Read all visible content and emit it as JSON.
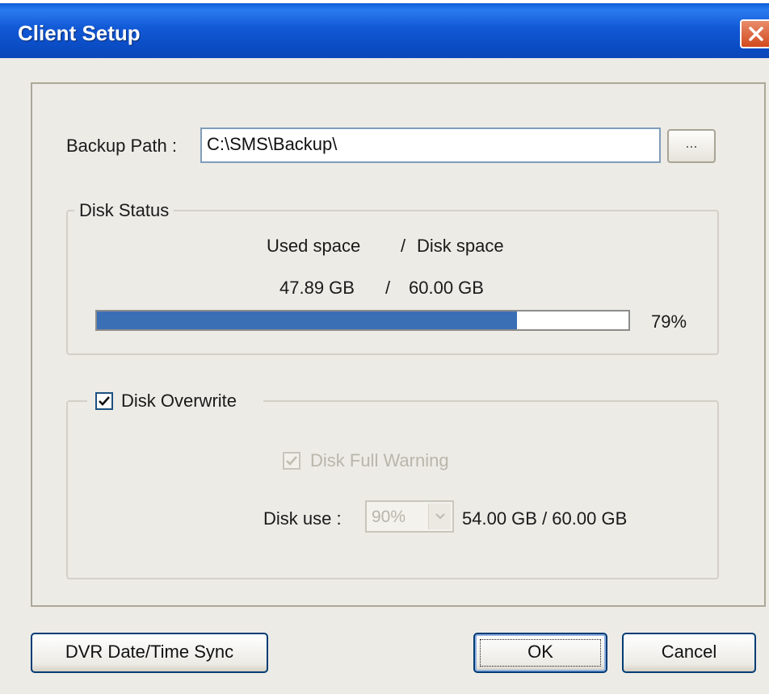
{
  "window": {
    "title": "Client Setup",
    "colors": {
      "titlebar": "#0a4cc4",
      "close": "#d24a1d",
      "progress": "#3a6fb6"
    }
  },
  "backup": {
    "label": "Backup Path :",
    "path_value": "C:\\SMS\\Backup\\",
    "browse_label": "..."
  },
  "disk_status": {
    "legend": "Disk Status",
    "used_label": "Used space",
    "separator": "/",
    "disk_label": "Disk space",
    "used_value": "47.89 GB",
    "disk_value": "60.00 GB",
    "percent_text": "79%",
    "percent_fraction": 0.79
  },
  "overwrite": {
    "label": "Disk Overwrite",
    "checked": true,
    "full_warning_label": "Disk Full Warning",
    "full_warning_checked": true,
    "full_warning_enabled": false,
    "disk_use_label": "Disk use :",
    "disk_use_value": "90%",
    "disk_use_summary": "54.00 GB / 60.00 GB"
  },
  "buttons": {
    "sync": "DVR Date/Time Sync",
    "ok": "OK",
    "cancel": "Cancel"
  },
  "icons": {
    "close": "close-x-icon",
    "check": "check-mark-icon",
    "dropdown": "chevron-down-icon"
  }
}
